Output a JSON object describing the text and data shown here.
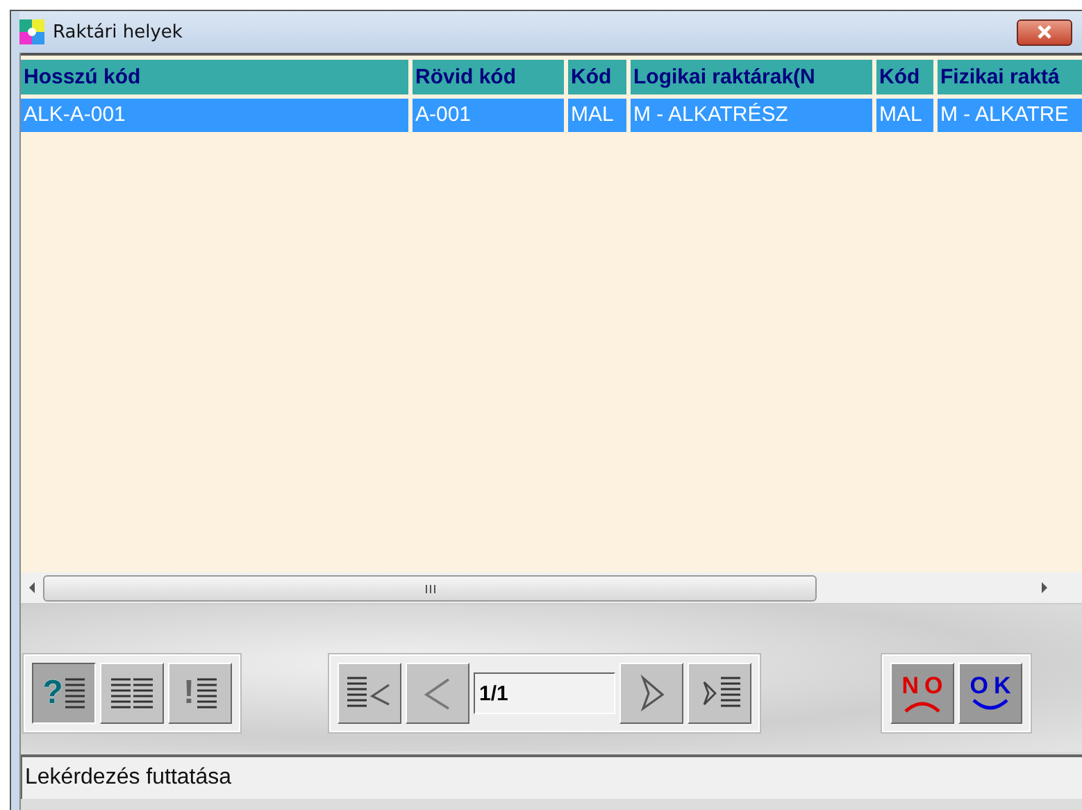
{
  "window": {
    "title": "Raktári helyek"
  },
  "table": {
    "columns": [
      "Hosszú kód",
      "Rövid kód",
      "Kód",
      "Logikai raktárak(N",
      "Kód",
      "Fizikai raktá"
    ],
    "rows": [
      {
        "selected": true,
        "cells": [
          "ALK-A-001",
          "A-001",
          "MAL",
          "M - ALKATRÉSZ",
          "MAL",
          "M - ALKATRE"
        ]
      }
    ]
  },
  "toolbar": {
    "left": [
      {
        "glyph": "?",
        "pressed": true
      },
      {
        "pressed": false
      },
      {
        "glyph": "!",
        "pressed": false
      }
    ],
    "page": "1/1",
    "right": [
      {
        "kind": "no",
        "label": "NO"
      },
      {
        "kind": "ok",
        "label": "OK"
      }
    ]
  },
  "status_bar": "Lekérdezés futtatása"
}
